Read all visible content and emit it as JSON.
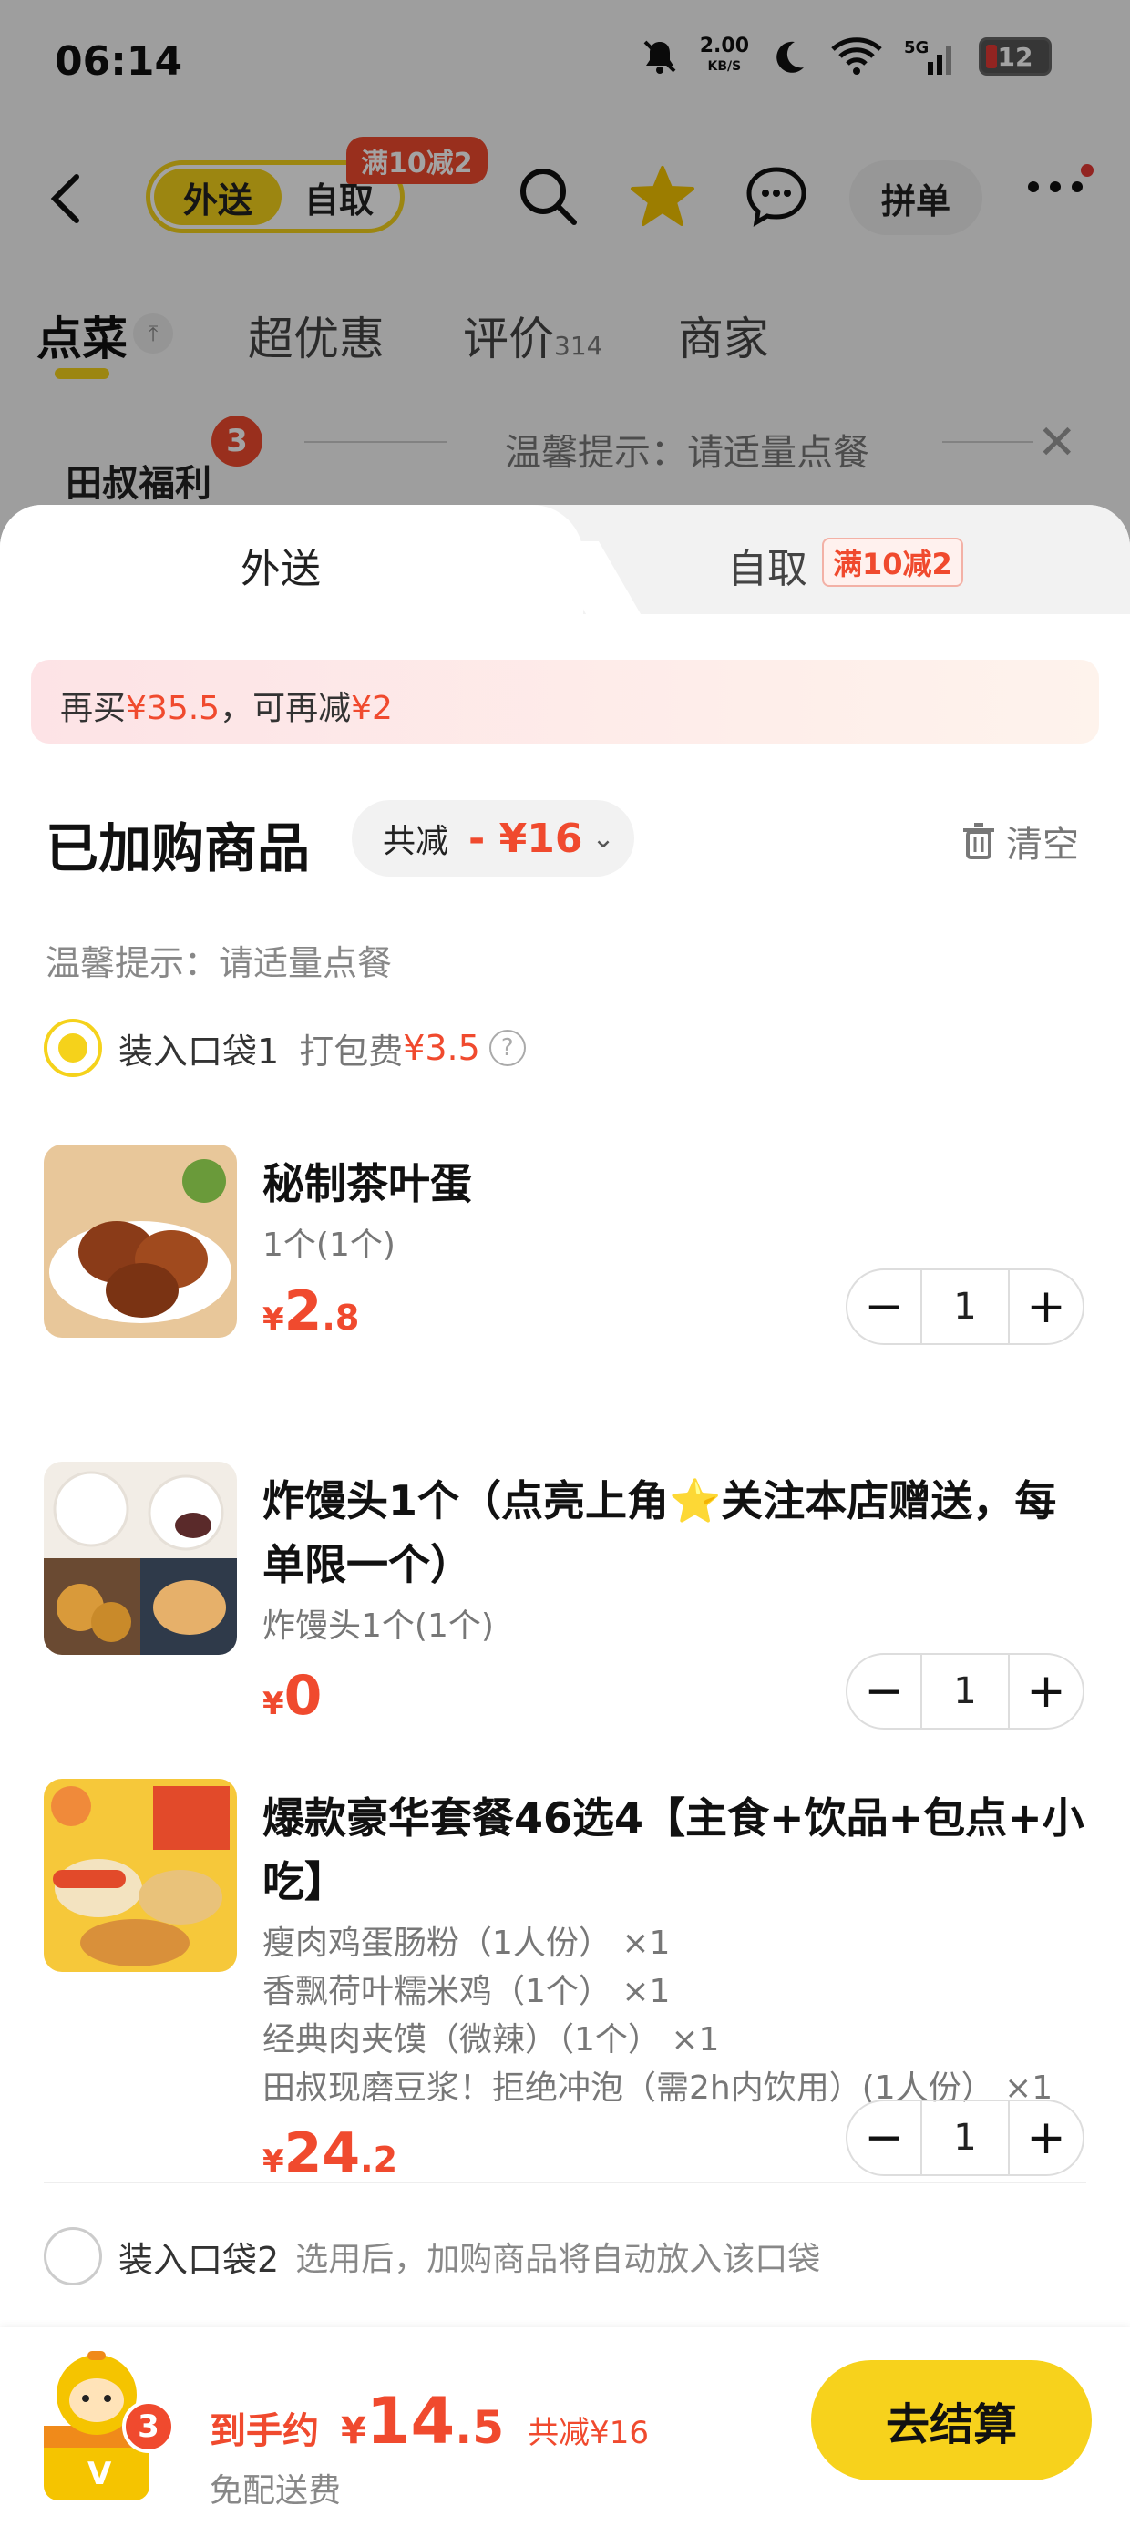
{
  "status_bar": {
    "time": "06:14",
    "net_speed": "2.00",
    "net_unit": "KB/S",
    "battery": "12",
    "net_label": "5G"
  },
  "top_nav": {
    "mode_active": "外送",
    "mode_inactive": "自取",
    "promo_tag": "满10减2",
    "group_button": "拼单"
  },
  "tabs": [
    {
      "label": "点菜",
      "sub": ""
    },
    {
      "label": "超优惠",
      "sub": ""
    },
    {
      "label": "评价",
      "sub": "314"
    },
    {
      "label": "商家",
      "sub": ""
    }
  ],
  "tip_bar": {
    "text": "温馨提示：请适量点餐",
    "store_label": "田叔福利",
    "store_badge": "3"
  },
  "sheet": {
    "tab_delivery": "外送",
    "tab_pickup": "自取",
    "pickup_tag": "满10减2",
    "buy_more": {
      "prefix": "再买",
      "amount": "¥35.5",
      "middle": "，可再减",
      "discount": "¥2"
    },
    "added_title": "已加购商品",
    "total_label": "共减",
    "total_amount": "- ¥16",
    "clear_label": "清空",
    "warm_tip": "温馨提示：请适量点餐",
    "bag1": {
      "label": "装入口袋1",
      "fee_label": "打包费",
      "fee_value": "¥3.5"
    },
    "items": [
      {
        "name": "秘制茶叶蛋",
        "subs": [
          "1个(1个)"
        ],
        "price_currency": "¥",
        "price_int": "2",
        "price_dec": ".8",
        "qty": "1"
      },
      {
        "name": "炸馒头1个（点亮上角⭐关注本店赠送，每单限一个）",
        "subs": [
          "炸馒头1个(1个)"
        ],
        "price_currency": "¥",
        "price_int": "0",
        "price_dec": "",
        "qty": "1"
      },
      {
        "name": "爆款豪华套餐46选4【主食+饮品+包点+小吃】",
        "subs": [
          "瘦肉鸡蛋肠粉（1人份） ×1",
          "香飘荷叶糯米鸡（1个） ×1",
          "经典肉夹馍（微辣）（1个） ×1",
          "田叔现磨豆浆！拒绝冲泡（需2h内饮用）(1人份） ×1"
        ],
        "price_currency": "¥",
        "price_int": "24",
        "price_dec": ".2",
        "qty": "1"
      }
    ],
    "bag2": {
      "label": "装入口袋2",
      "hint": "选用后，加购商品将自动放入该口袋"
    }
  },
  "footer": {
    "cart_count": "3",
    "est_label": "到手约",
    "est_currency": "¥",
    "est_int": "14",
    "est_dec": ".5",
    "save_text": "共减¥16",
    "shipping": "免配送费",
    "checkout": "去结算"
  },
  "colors": {
    "accent_yellow": "#f5d21b",
    "price_red": "#f04a2e"
  }
}
